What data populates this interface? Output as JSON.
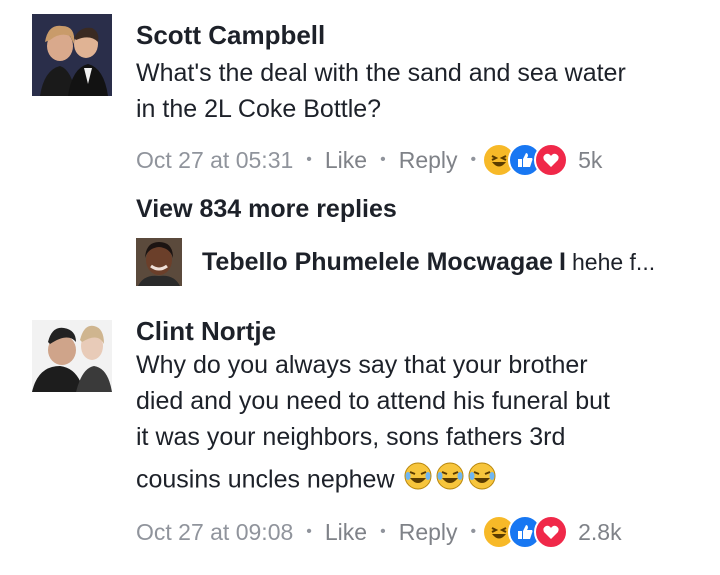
{
  "comments": [
    {
      "author": "Scott Campbell",
      "text": "What's the deal with the sand and sea water in the 2L Coke Bottle?",
      "timestamp": "Oct 27 at 05:31",
      "like_label": "Like",
      "reply_label": "Reply",
      "reaction_count": "5k",
      "reactions": [
        "haha-icon",
        "like-icon",
        "love-icon"
      ]
    },
    {
      "author": "Clint Nortje",
      "text_lines": [
        "Why do you always say that your brother",
        "died and you need to attend his funeral but",
        "it was your neighbors, sons fathers 3rd",
        "cousins uncles nephew"
      ],
      "inline_emojis": [
        "crying-laughing-emoji",
        "crying-laughing-emoji",
        "crying-laughing-emoji"
      ],
      "timestamp": "Oct 27 at 09:08",
      "like_label": "Like",
      "reply_label": "Reply",
      "reaction_count": "2.8k",
      "reactions": [
        "haha-icon",
        "like-icon",
        "love-icon"
      ]
    }
  ],
  "view_more_replies": "View 834 more replies",
  "reply_preview": {
    "author": "Tebello Phumelele Mocwagae",
    "separator": "I",
    "text": "hehe f..."
  },
  "colors": {
    "text": "#1d2129",
    "meta": "#90949c",
    "like_blue": "#1877f2",
    "love_red": "#f02849",
    "haha_yellow": "#f7b928"
  }
}
